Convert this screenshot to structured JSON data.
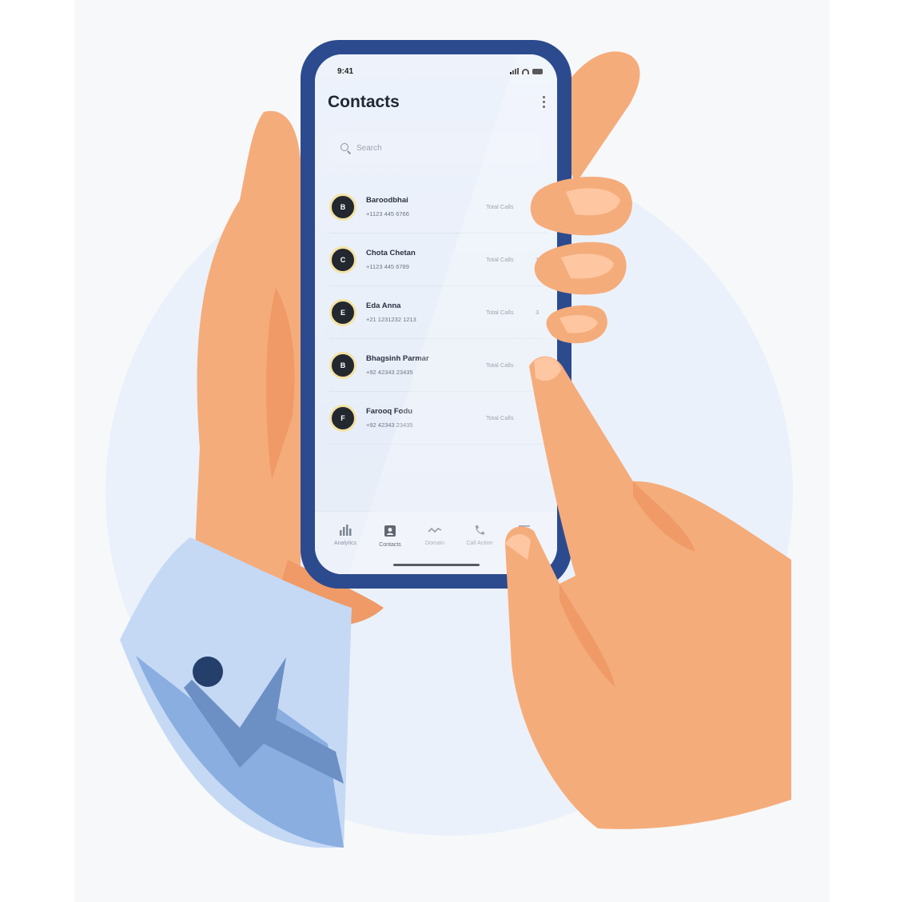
{
  "colors": {
    "phone_frame": "#2c4a8e",
    "skin": "#f5ac7b",
    "skin_shadow": "#ef9a67",
    "sleeve": "#c5d9f5",
    "sleeve_dark": "#8aaee0",
    "button": "#253f6b",
    "background_circle": "#eaf1fa",
    "avatar_ring": "#f2e3a6"
  },
  "status_bar": {
    "time": "9:41"
  },
  "header": {
    "title": "Contacts",
    "menu_icon": "kebab-menu-icon"
  },
  "search": {
    "placeholder": "Search",
    "icon": "search-icon"
  },
  "contacts": [
    {
      "initial": "B",
      "name": "Baroodbhai",
      "phone": "+1123 445 6766",
      "calls_label": "Total Calls",
      "count": ""
    },
    {
      "initial": "C",
      "name": "Chota Chetan",
      "phone": "+1123 445 6789",
      "calls_label": "Total Calls",
      "count": "10"
    },
    {
      "initial": "E",
      "name": "Eda Anna",
      "phone": "+21 1231232 1213",
      "calls_label": "Total Calls",
      "count": "3"
    },
    {
      "initial": "B",
      "name": "Bhagsinh Parmar",
      "phone": "+92 42343 23435",
      "calls_label": "Total Calls",
      "count": ""
    },
    {
      "initial": "F",
      "name": "Farooq Fodu",
      "phone": "+92 42343 23435",
      "calls_label": "Total Calls",
      "count": ""
    }
  ],
  "tabs": [
    {
      "label": "Analytics",
      "icon": "bar-chart-icon",
      "active": false
    },
    {
      "label": "Contacts",
      "icon": "contact-card-icon",
      "active": true
    },
    {
      "label": "Domain",
      "icon": "route-icon",
      "active": false
    },
    {
      "label": "Call Action",
      "icon": "phone-icon",
      "active": false
    },
    {
      "label": "",
      "icon": "menu-icon",
      "active": false
    }
  ]
}
